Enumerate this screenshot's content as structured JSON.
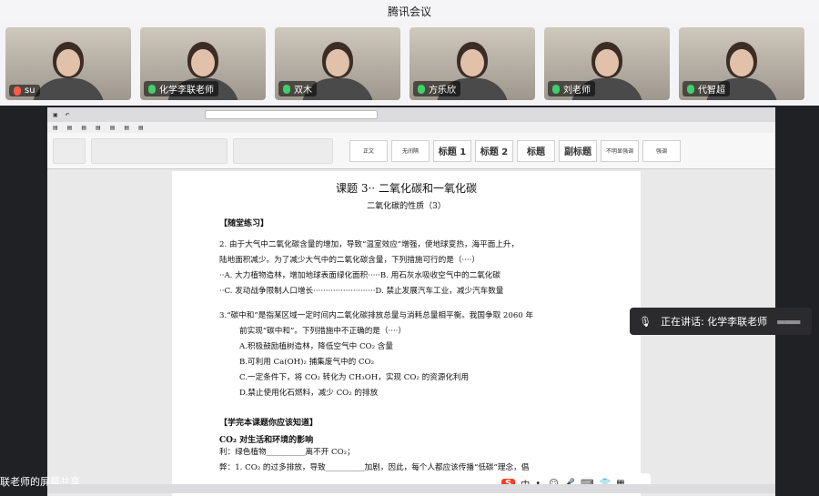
{
  "app": {
    "title": "腾讯会议"
  },
  "participants": [
    {
      "name": "su",
      "muted": true
    },
    {
      "name": "化学李联老师",
      "muted": false
    },
    {
      "name": "双木",
      "muted": false
    },
    {
      "name": "方乐欣",
      "muted": false
    },
    {
      "name": "刘老师",
      "muted": false
    },
    {
      "name": "代智超",
      "muted": false
    }
  ],
  "speaker": {
    "label": "正在讲话: 化学李联老师"
  },
  "share": {
    "label": "联老师的屏幕共享"
  },
  "ribbon": {
    "styles": [
      "正文",
      "无间隔",
      "标题 1",
      "标题 2",
      "标题",
      "副标题",
      "不明显强调",
      "强调"
    ]
  },
  "document": {
    "title": "课题 3·· 二氧化碳和一氧化碳",
    "subtitle": "二氧化碳的性质（3）",
    "section1": "【随堂练习】",
    "q2_line1": "2. 由于大气中二氧化碳含量的增加，导致“温室效应”增强，使地球变热，海平面上升，",
    "q2_line2": "陆地面积减少。为了减少大气中的二氧化碳含量，下列措施可行的是（····）",
    "q2_ab": "··A. 大力植物造林，增加地球表面绿化面积·····B. 用石灰水吸收空气中的二氧化碳",
    "q2_cd": "··C. 发动战争限制人口增长·························D. 禁止发展汽车工业，减少汽车数量",
    "q3_line1": "3.“碳中和”是指某区域一定时间内二氧化碳排放总量与消耗总量相平衡。我国争取 2060 年",
    "q3_line2": "前实现“碳中和”。下列措施中不正确的是（····）",
    "q3_a": "A.积极鼓励植树造林，降低空气中 CO₂ 含量",
    "q3_b": "B.可利用 Ca(OH)₂ 捕集废气中的 CO₂",
    "q3_c": "C.一定条件下，将 CO₂ 转化为 CH₃OH，实现 CO₂ 的资源化利用",
    "q3_d": "D.禁止使用化石燃料，减少 CO₂ 的排放",
    "section2": "【学完本课题你应该知道】",
    "section3": "CO₂ 对生活和环境的影响",
    "benefit": "利：绿色植物__________离不开 CO₂；",
    "harm1": "弊：1. CO₂ 的过多排放，导致__________加剧，因此，每个人都应该传播“低碳”理念，倡"
  }
}
